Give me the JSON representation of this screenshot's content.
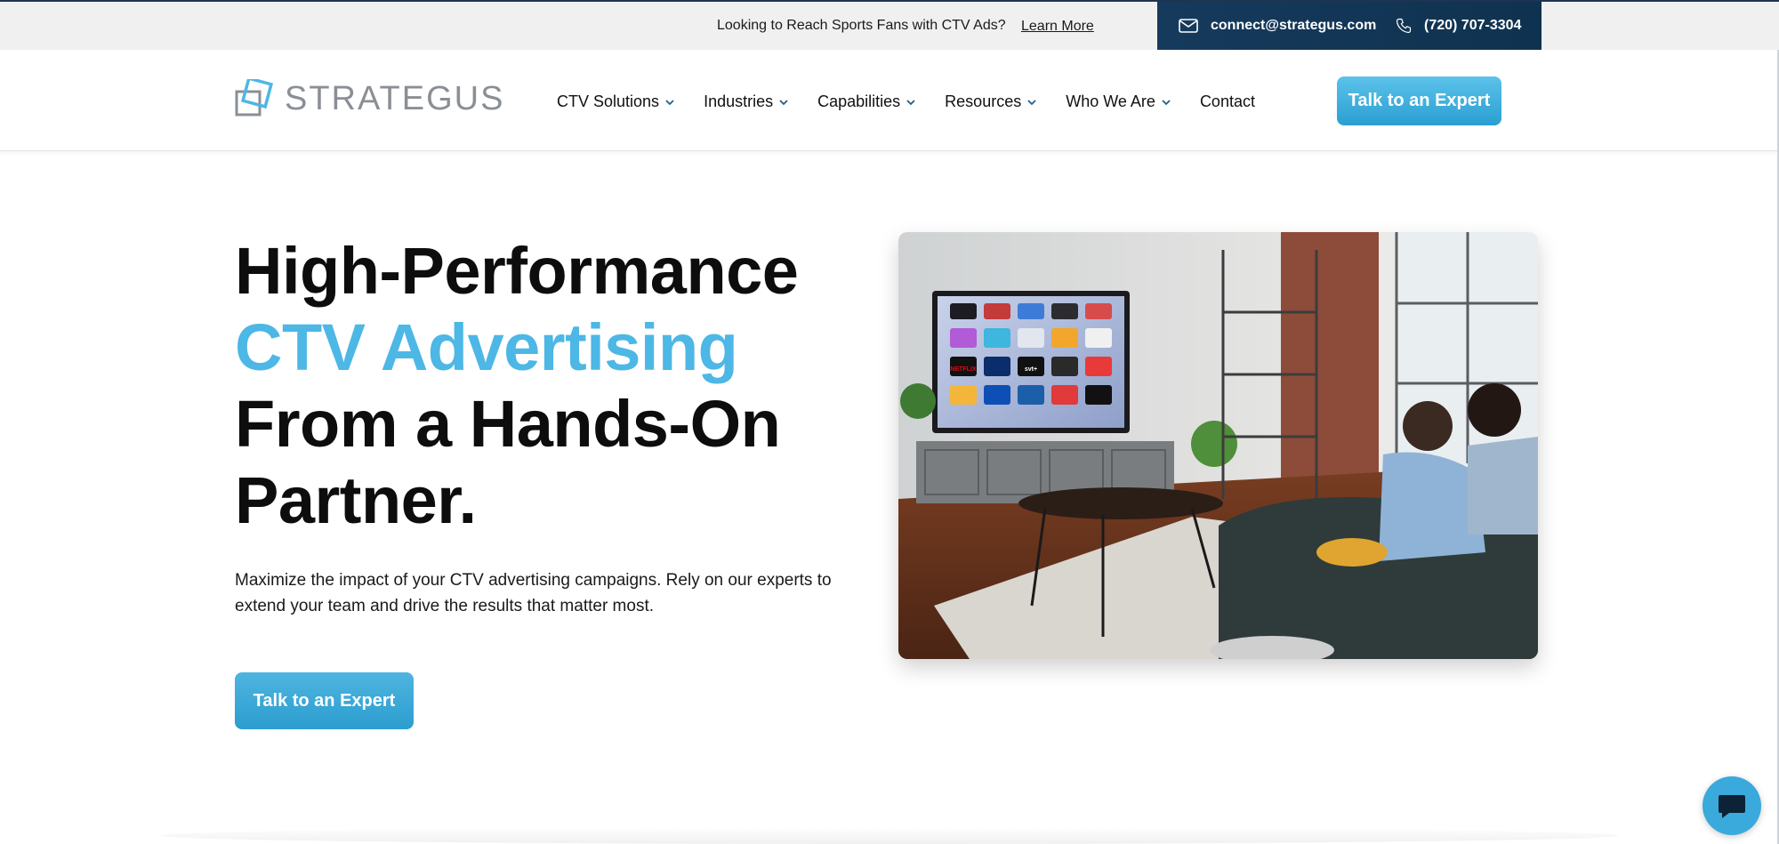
{
  "topbar": {
    "promo_text": "Looking to Reach Sports Fans with CTV Ads?",
    "learn_more": "Learn More",
    "email": "connect@strategus.com",
    "phone": "(720) 707-3304"
  },
  "header": {
    "logo_text": "STRATEGUS",
    "nav": [
      {
        "label": "CTV Solutions",
        "has_dropdown": true
      },
      {
        "label": "Industries",
        "has_dropdown": true
      },
      {
        "label": "Capabilities",
        "has_dropdown": true
      },
      {
        "label": "Resources",
        "has_dropdown": true
      },
      {
        "label": "Who We Are",
        "has_dropdown": true
      },
      {
        "label": "Contact",
        "has_dropdown": false
      }
    ],
    "cta_label": "Talk to an Expert"
  },
  "hero": {
    "title_line1": "High-Performance",
    "title_accent": "CTV Advertising",
    "title_line3": "From a Hands-On",
    "title_line4": "Partner.",
    "subtitle": "Maximize the impact of your CTV advertising campaigns. Rely on our experts to extend your team and drive the results that matter most.",
    "cta_label": "Talk to an Expert",
    "tv_app_labels": [
      "NETFLIX",
      "svt+"
    ]
  },
  "colors": {
    "accent": "#4db7e5",
    "navy": "#163a5c",
    "button": "#2b9dcf"
  },
  "icons": {
    "mail": "mail-icon",
    "phone": "phone-icon",
    "chevron": "chevron-down-icon",
    "chat": "chat-icon"
  }
}
